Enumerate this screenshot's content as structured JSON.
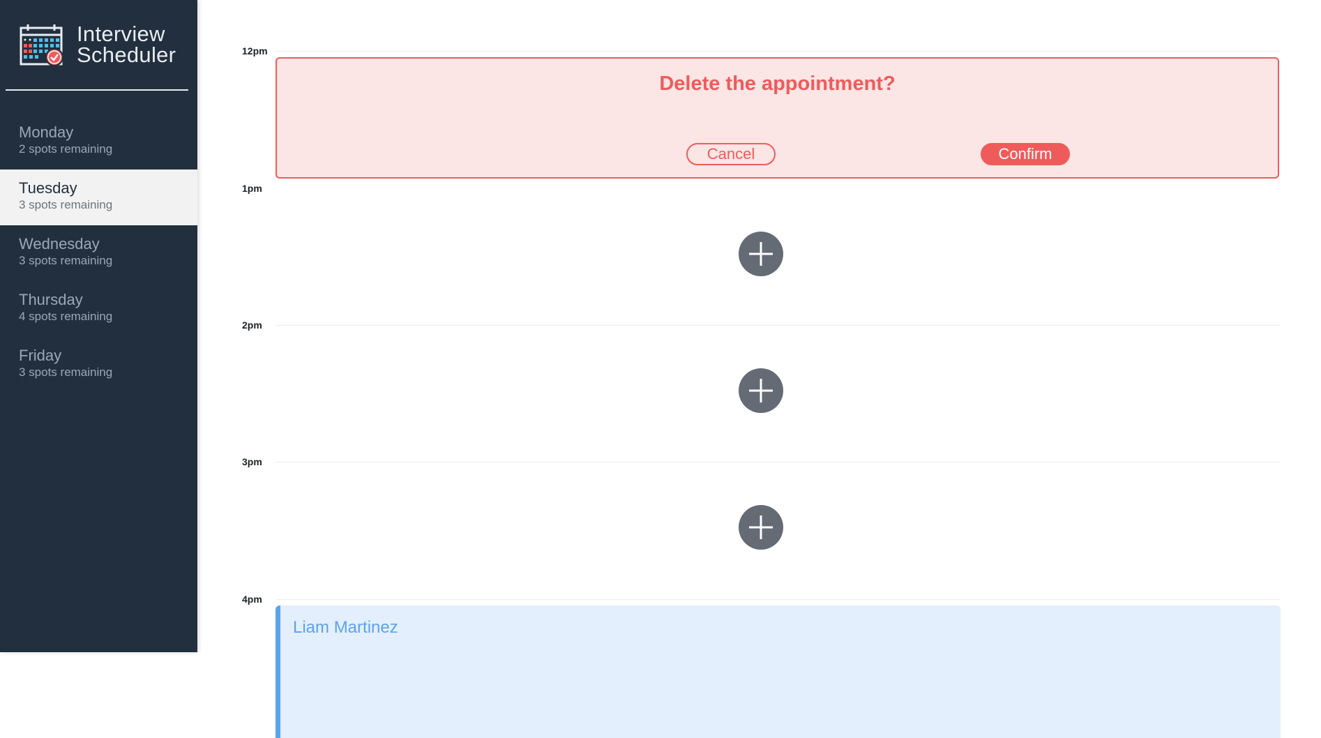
{
  "app": {
    "title_line1": "Interview",
    "title_line2": "Scheduler",
    "colors": {
      "sidebar_bg": "#222f3e",
      "selected_bg": "#f2f2f2",
      "danger": "#ef5b5b",
      "danger_bg": "#fbe5e5",
      "appointment_accent": "#5aa3ee",
      "appointment_bg": "#e4effd",
      "add_button": "#646b75"
    }
  },
  "days": [
    {
      "name": "Monday",
      "spots": "2 spots remaining",
      "selected": false
    },
    {
      "name": "Tuesday",
      "spots": "3 spots remaining",
      "selected": true
    },
    {
      "name": "Wednesday",
      "spots": "3 spots remaining",
      "selected": false
    },
    {
      "name": "Thursday",
      "spots": "4 spots remaining",
      "selected": false
    },
    {
      "name": "Friday",
      "spots": "3 spots remaining",
      "selected": false
    }
  ],
  "schedule": {
    "slots": [
      {
        "time": "12pm",
        "state": "confirm",
        "message": "Delete the appointment?",
        "cancel_label": "Cancel",
        "confirm_label": "Confirm"
      },
      {
        "time": "1pm",
        "state": "empty",
        "icon": "add-icon"
      },
      {
        "time": "2pm",
        "state": "empty",
        "icon": "add-icon"
      },
      {
        "time": "3pm",
        "state": "empty",
        "icon": "add-icon"
      },
      {
        "time": "4pm",
        "state": "booked",
        "student": "Liam Martinez"
      }
    ]
  }
}
